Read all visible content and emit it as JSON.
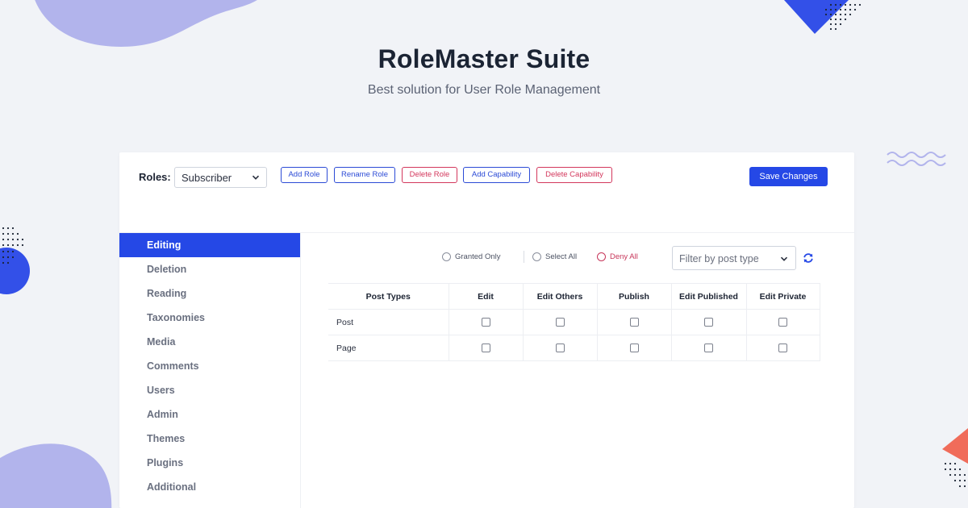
{
  "hero": {
    "title": "RoleMaster Suite",
    "subtitle": "Best solution for User Role Management"
  },
  "toolbar": {
    "roles_label": "Roles:",
    "role_selected": "Subscriber",
    "buttons": {
      "add_role": "Add Role",
      "rename_role": "Rename Role",
      "delete_role": "Delete Role",
      "add_capability": "Add Capability",
      "delete_capability": "Delete Capability"
    },
    "save_label": "Save Changes"
  },
  "sidebar": {
    "items": [
      {
        "label": "Editing",
        "active": true
      },
      {
        "label": "Deletion"
      },
      {
        "label": "Reading"
      },
      {
        "label": "Taxonomies"
      },
      {
        "label": "Media"
      },
      {
        "label": "Comments"
      },
      {
        "label": "Users"
      },
      {
        "label": "Admin"
      },
      {
        "label": "Themes"
      },
      {
        "label": "Plugins"
      },
      {
        "label": "Additional"
      }
    ]
  },
  "filters": {
    "granted_only": "Granted Only",
    "select_all": "Select All",
    "deny_all": "Deny All",
    "post_type_placeholder": "Filter by post type"
  },
  "table": {
    "headers": [
      "Post Types",
      "Edit",
      "Edit Others",
      "Publish",
      "Edit Published",
      "Edit Private"
    ],
    "rows": [
      {
        "name": "Post",
        "checked": [
          false,
          false,
          false,
          false,
          false
        ]
      },
      {
        "name": "Page",
        "checked": [
          false,
          false,
          false,
          false,
          false
        ]
      }
    ]
  },
  "colors": {
    "accent": "#2548e6",
    "danger": "#d3375c",
    "background": "#f1f3f7",
    "blob": "#b2b4ec",
    "coral": "#f06c5a"
  },
  "icons": {
    "role_chevron": "chevron-down-icon",
    "filter_chevron": "chevron-down-icon",
    "refresh": "refresh-icon"
  }
}
